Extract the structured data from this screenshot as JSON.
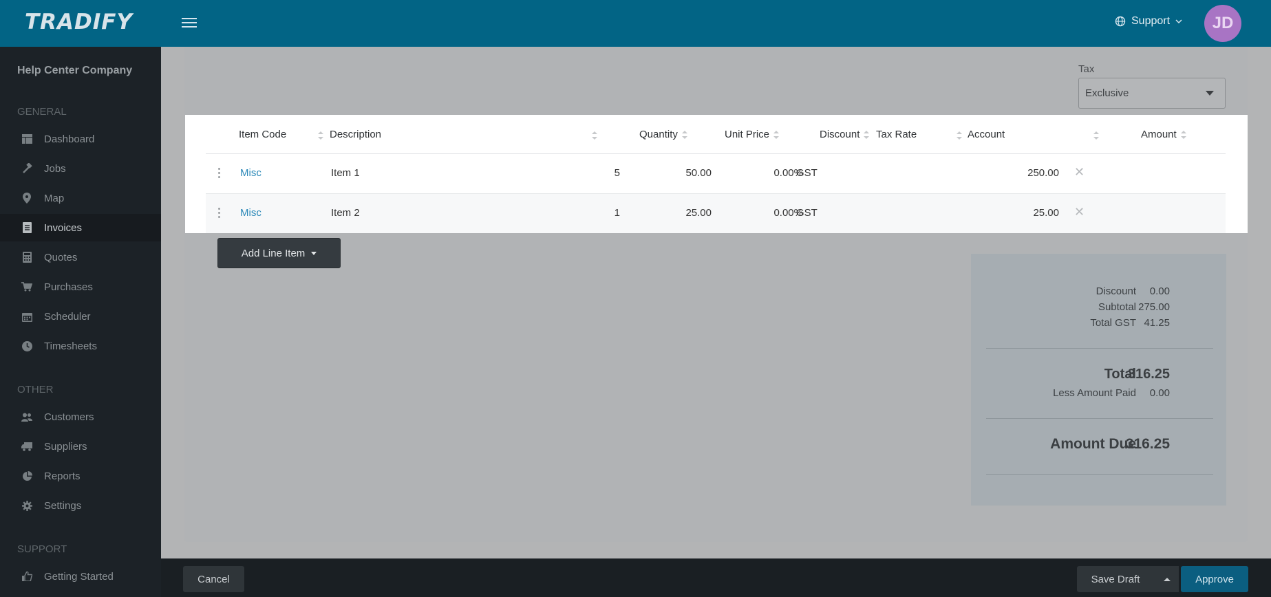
{
  "app": {
    "logo": "TRADIFY"
  },
  "header": {
    "support_label": "Support",
    "avatar_initials": "JD",
    "avatar_color": "#a874c4",
    "brand_color": "#026485"
  },
  "sidebar": {
    "company": "Help Center Company",
    "sections": {
      "general": "GENERAL",
      "other": "OTHER",
      "support": "SUPPORT"
    },
    "general_items": [
      {
        "label": "Dashboard",
        "icon": "dashboard-icon"
      },
      {
        "label": "Jobs",
        "icon": "hammer-icon"
      },
      {
        "label": "Map",
        "icon": "map-pin-icon"
      },
      {
        "label": "Invoices",
        "icon": "invoice-icon",
        "active": true
      },
      {
        "label": "Quotes",
        "icon": "calculator-icon"
      },
      {
        "label": "Purchases",
        "icon": "cart-icon"
      },
      {
        "label": "Scheduler",
        "icon": "calendar-icon"
      },
      {
        "label": "Timesheets",
        "icon": "clock-icon"
      }
    ],
    "other_items": [
      {
        "label": "Customers",
        "icon": "users-icon"
      },
      {
        "label": "Suppliers",
        "icon": "truck-icon"
      },
      {
        "label": "Reports",
        "icon": "pie-chart-icon"
      },
      {
        "label": "Settings",
        "icon": "gear-icon"
      }
    ],
    "support_items": [
      {
        "label": "Getting Started",
        "icon": "thumbs-up-icon"
      }
    ]
  },
  "tax": {
    "label": "Tax",
    "value": "Exclusive"
  },
  "table": {
    "headers": [
      "Item Code",
      "Description",
      "Quantity",
      "Unit Price",
      "Discount",
      "Tax Rate",
      "Account",
      "Amount"
    ],
    "rows": [
      {
        "item_code": "Misc",
        "description": "Item 1",
        "quantity": "5",
        "unit_price": "50.00",
        "discount": "0.00%",
        "tax_rate": "GST",
        "account": "",
        "amount": "250.00"
      },
      {
        "item_code": "Misc",
        "description": "Item 2",
        "quantity": "1",
        "unit_price": "25.00",
        "discount": "0.00%",
        "tax_rate": "GST",
        "account": "",
        "amount": "25.00"
      }
    ]
  },
  "add_line_item_label": "Add Line Item",
  "totals": {
    "discount_label": "Discount",
    "discount": "0.00",
    "subtotal_label": "Subtotal",
    "subtotal": "275.00",
    "total_gst_label": "Total GST",
    "total_gst": "41.25",
    "total_label": "Total",
    "total": "316.25",
    "less_paid_label": "Less Amount Paid",
    "less_paid": "0.00",
    "amount_due_label": "Amount Due",
    "amount_due": "316.25"
  },
  "footer": {
    "cancel_label": "Cancel",
    "save_draft_label": "Save Draft",
    "approve_label": "Approve"
  }
}
